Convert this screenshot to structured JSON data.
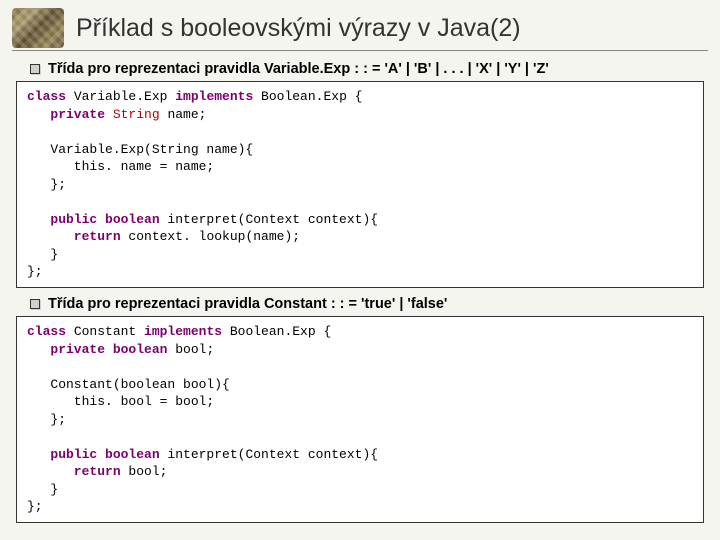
{
  "title": "Příklad s booleovskými výrazy v Java(2)",
  "section1": {
    "bullet": "Třída pro reprezentaci pravidla Variable.Exp : : = 'A' | 'B' | . . . | 'X' | 'Y' | 'Z'",
    "code": {
      "l1a": "class",
      "l1b": " Variable.Exp ",
      "l1c": "implements",
      "l1d": " Boolean.Exp {",
      "l2a": "   private ",
      "l2b": "String",
      "l2c": " name;",
      "l3a": "   Variable.Exp(String name){",
      "l4a": "      this. name = name;",
      "l5a": "   };",
      "l6a": "   public boolean",
      "l6b": " interpret(Context context){",
      "l7a": "      return",
      "l7b": " context. lookup(name);",
      "l8a": "   }",
      "l9a": "};"
    }
  },
  "section2": {
    "bullet": "Třída pro reprezentaci pravidla Constant : : = 'true' | 'false'",
    "code": {
      "l1a": "class",
      "l1b": " Constant ",
      "l1c": "implements",
      "l1d": " Boolean.Exp {",
      "l2a": "   private ",
      "l2b": "boolean",
      "l2c": " bool;",
      "l3a": "   Constant(boolean bool){",
      "l4a": "      this. bool = bool;",
      "l5a": "   };",
      "l6a": "   public boolean",
      "l6b": " interpret(Context context){",
      "l7a": "      return",
      "l7b": " bool;",
      "l8a": "   }",
      "l9a": "};"
    }
  }
}
